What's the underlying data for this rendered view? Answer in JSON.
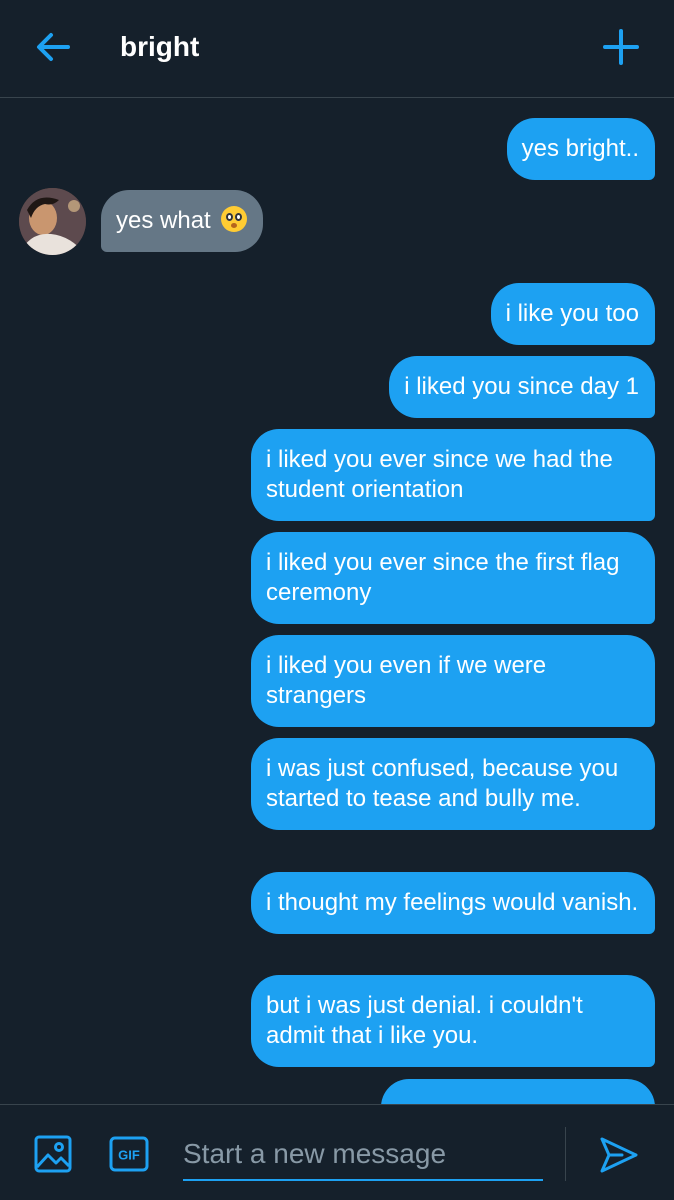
{
  "header": {
    "title": "bright"
  },
  "colors": {
    "background": "#15202b",
    "accent": "#1da1f2",
    "received_bubble": "#657786",
    "divider": "#38444d"
  },
  "messages": [
    {
      "direction": "sent",
      "text": "yes bright.."
    },
    {
      "direction": "received",
      "text": "yes what",
      "emoji": "flushed-face-emoji"
    },
    {
      "direction": "sent",
      "text": "i like you too"
    },
    {
      "direction": "sent",
      "text": "i liked you since day 1"
    },
    {
      "direction": "sent",
      "text": "i liked you ever since we had the student orientation"
    },
    {
      "direction": "sent",
      "text": "i liked you ever since the first flag ceremony"
    },
    {
      "direction": "sent",
      "text": "i liked you even if we were strangers"
    },
    {
      "direction": "sent",
      "text": "i was just confused, because you started to tease and bully me."
    },
    {
      "direction": "sent",
      "text": "i thought my feelings would vanish."
    },
    {
      "direction": "sent",
      "text": "but i was just denial. i couldn't admit that i like you."
    },
    {
      "direction": "sent",
      "text": ""
    }
  ],
  "composer": {
    "placeholder": "Start a new message",
    "value": "",
    "gif_label": "GIF"
  },
  "icons": {
    "back": "back-arrow-icon",
    "add": "plus-icon",
    "image": "image-icon",
    "gif": "gif-icon",
    "send": "send-icon"
  }
}
